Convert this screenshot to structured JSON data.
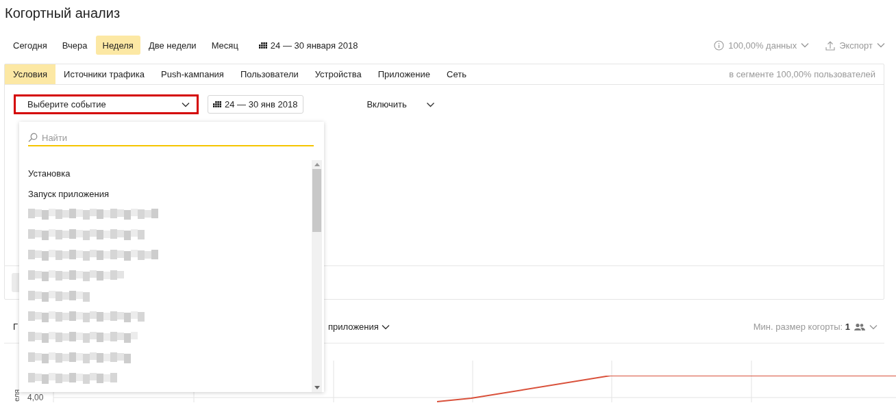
{
  "page": {
    "title": "Когортный анализ"
  },
  "periods": [
    {
      "label": "Сегодня",
      "selected": false
    },
    {
      "label": "Вчера",
      "selected": false
    },
    {
      "label": "Неделя",
      "selected": true
    },
    {
      "label": "Две недели",
      "selected": false
    },
    {
      "label": "Месяц",
      "selected": false
    }
  ],
  "date_range": "24 — 30 января 2018",
  "data_share": "100,00% данных",
  "export": "Экспорт",
  "tabs": [
    {
      "label": "Условия",
      "selected": true
    },
    {
      "label": "Источники трафика",
      "selected": false
    },
    {
      "label": "Push-кампания",
      "selected": false
    },
    {
      "label": "Пользователи",
      "selected": false
    },
    {
      "label": "Устройства",
      "selected": false
    },
    {
      "label": "Приложение",
      "selected": false
    },
    {
      "label": "Сеть",
      "selected": false
    }
  ],
  "segment_note": "в сегменте 100,00% пользователей",
  "event_select": {
    "value": "Выберите событие",
    "highlighted": true
  },
  "event_dates": "24 — 30 янв 2018",
  "include": "Включить",
  "event_dropdown": {
    "search": {
      "placeholder": "Найти"
    },
    "items": [
      {
        "kind": "text",
        "label": "Установка"
      },
      {
        "kind": "text",
        "label": "Запуск приложения"
      },
      {
        "kind": "redacted"
      },
      {
        "kind": "redacted"
      },
      {
        "kind": "redacted"
      },
      {
        "kind": "redacted"
      },
      {
        "kind": "redacted"
      },
      {
        "kind": "redacted"
      },
      {
        "kind": "redacted"
      },
      {
        "kind": "redacted"
      },
      {
        "kind": "redacted"
      }
    ]
  },
  "report_bar": {
    "left_label": "Г",
    "metric": "приложения",
    "min_cohort": "Мин. размер когорты: **1**"
  },
  "chart": {
    "y_title": "еля",
    "y_tick": "4,00"
  }
}
